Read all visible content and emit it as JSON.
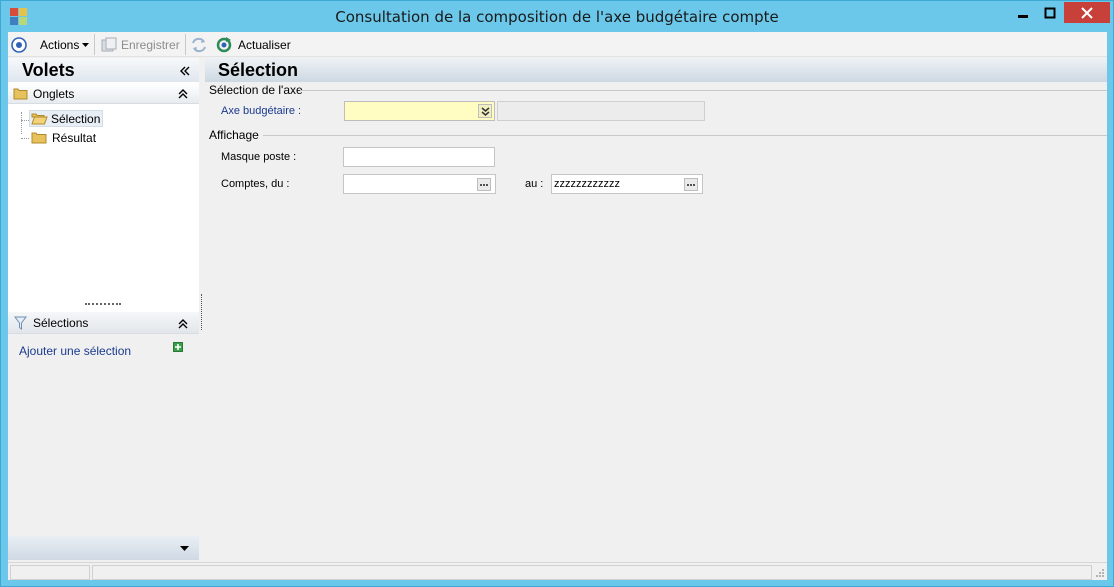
{
  "window": {
    "title": "Consultation de la composition de l'axe budgétaire compte",
    "icons": [
      "app-icon",
      "minimize-icon",
      "maximize-icon",
      "close-icon"
    ],
    "close_color": "#c7403a",
    "frame_color": "#6bc8ea"
  },
  "toolbar": {
    "actions_label": "Actions",
    "save_label": "Enregistrer",
    "refresh_label": "Actualiser"
  },
  "left_pane": {
    "title": "Volets",
    "tabs_header": "Onglets",
    "tabs": [
      {
        "label": "Sélection",
        "selected": true
      },
      {
        "label": "Résultat",
        "selected": false
      }
    ],
    "selections_header": "Sélections",
    "add_selection_label": "Ajouter une sélection"
  },
  "main": {
    "title": "Sélection",
    "axis_group": {
      "title": "Sélection de l'axe",
      "axis_label": "Axe budgétaire :",
      "axis_value": "",
      "axis_description": ""
    },
    "display_group": {
      "title": "Affichage",
      "mask_label": "Masque poste :",
      "mask_value": "",
      "accounts_from_label": "Comptes, du :",
      "accounts_from_value": "",
      "accounts_to_label": "au :",
      "accounts_to_value": "zzzzzzzzzzzz"
    }
  },
  "colors": {
    "accent": "#1b3a8f",
    "combo_bg": "#fffdc2",
    "header_gradient": [
      "#eef2f6",
      "#cdd8e3"
    ]
  }
}
